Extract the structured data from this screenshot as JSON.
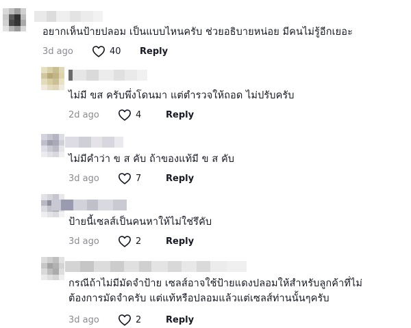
{
  "comments": [
    {
      "text_lines": [
        "อยากเห็นป้ายปลอม เป็นแบบไหนครับ ช่วยอธิบายหน่อย มีคนไม่รู้อีกเยอะ"
      ],
      "time": "3d ago",
      "likes": "40",
      "reply": "Reply",
      "is_reply": false
    },
    {
      "text_lines": [
        "ไม่มี ขส ครับพึ่งโดนมา แต่ตำรวจให้ถอด ไม่ปรับครับ"
      ],
      "time": "2d ago",
      "likes": "4",
      "reply": "Reply",
      "is_reply": true
    },
    {
      "text_lines": [
        "ไม่มีคำว่า ข ส คับ ถ้าของแท้มี ข ส คับ"
      ],
      "time": "3d ago",
      "likes": "7",
      "reply": "Reply",
      "is_reply": true
    },
    {
      "text_lines": [
        "ป้ายนี้เซลส์เป็นคนหาให้ไม่ใช่รึคับ"
      ],
      "time": "3d ago",
      "likes": "2",
      "reply": "Reply",
      "is_reply": true
    },
    {
      "text_lines": [
        "กรณีถ้าไม่มีมัดจำป้าย เซลส์อาจใช้ป้ายแดงปลอมให้สำหรับลูกค้าที่ไม่",
        "ต้องการมัดจำครับ แต่แท้หรือปลอมแล้วแต่เซลส์ท่านนั้นๆครับ"
      ],
      "time": "3d ago",
      "likes": "2",
      "reply": "Reply",
      "is_reply": true
    }
  ],
  "icons": {
    "like": "heart-outline-icon"
  },
  "colors": {
    "text": "#161823",
    "muted": "#8a8b91",
    "background": "#ffffff"
  }
}
